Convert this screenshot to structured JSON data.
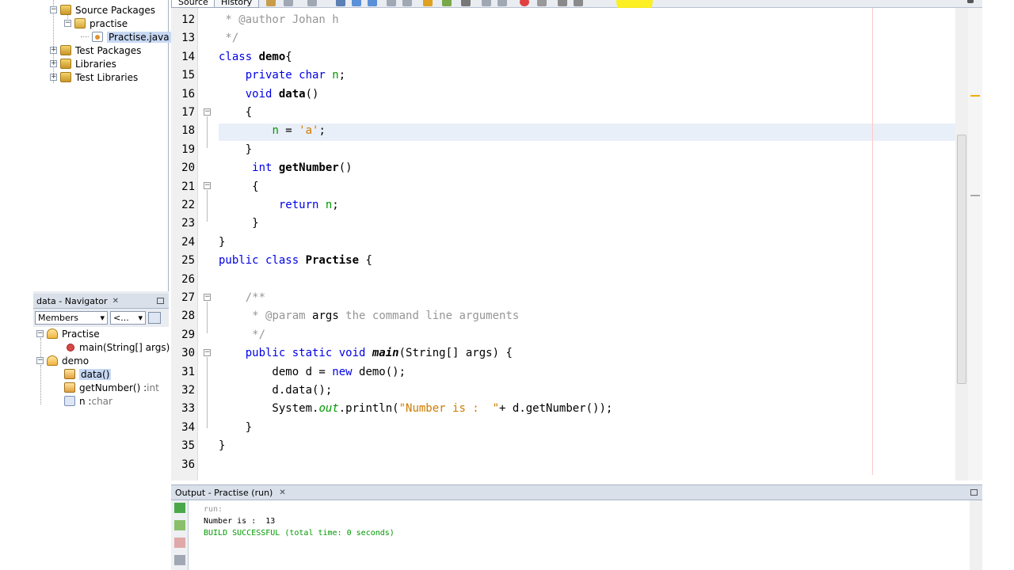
{
  "projects": {
    "items": [
      {
        "label": "Source Packages"
      },
      {
        "label": "practise"
      },
      {
        "label": "Practise.java"
      },
      {
        "label": "Test Packages"
      },
      {
        "label": "Libraries"
      },
      {
        "label": "Test Libraries"
      }
    ]
  },
  "navigator": {
    "title": "data - Navigator",
    "filter": "Members",
    "filter2": "<...",
    "items": [
      {
        "label": "Practise"
      },
      {
        "label": "main(String[] args)"
      },
      {
        "label": "demo"
      },
      {
        "label": "data()"
      },
      {
        "label": "getNumber() : ",
        "type": "int"
      },
      {
        "label": "n : ",
        "type": "char"
      }
    ]
  },
  "editor": {
    "tabs": {
      "source": "Source",
      "history": "History"
    },
    "lines": [
      {
        "n": "12",
        "tokens": [
          {
            "t": " * @author Johan h",
            "c": "cm"
          }
        ]
      },
      {
        "n": "13",
        "tokens": [
          {
            "t": " */",
            "c": "cm"
          }
        ]
      },
      {
        "n": "14",
        "tokens": [
          {
            "t": "class ",
            "c": "kw"
          },
          {
            "t": "demo",
            "c": "bold"
          },
          {
            "t": "{",
            "c": ""
          }
        ]
      },
      {
        "n": "15",
        "tokens": [
          {
            "t": "    private char ",
            "c": "kw"
          },
          {
            "t": "n",
            "c": "fld"
          },
          {
            "t": ";",
            "c": ""
          }
        ]
      },
      {
        "n": "16",
        "tokens": [
          {
            "t": "    void ",
            "c": "kw"
          },
          {
            "t": "data",
            "c": "bold"
          },
          {
            "t": "()",
            "c": ""
          }
        ]
      },
      {
        "n": "17",
        "tokens": [
          {
            "t": "    {",
            "c": ""
          }
        ]
      },
      {
        "n": "18",
        "tokens": [
          {
            "t": "        ",
            "c": ""
          },
          {
            "t": "n",
            "c": "fld"
          },
          {
            "t": " = ",
            "c": ""
          },
          {
            "t": "'a'",
            "c": "str"
          },
          {
            "t": ";",
            "c": ""
          }
        ]
      },
      {
        "n": "19",
        "tokens": [
          {
            "t": "    }",
            "c": ""
          }
        ]
      },
      {
        "n": "20",
        "tokens": [
          {
            "t": "     int ",
            "c": "kw"
          },
          {
            "t": "getNumber",
            "c": "bold"
          },
          {
            "t": "()",
            "c": ""
          }
        ]
      },
      {
        "n": "21",
        "tokens": [
          {
            "t": "     {",
            "c": ""
          }
        ]
      },
      {
        "n": "22",
        "tokens": [
          {
            "t": "         return ",
            "c": "kw"
          },
          {
            "t": "n",
            "c": "fld"
          },
          {
            "t": ";",
            "c": ""
          }
        ]
      },
      {
        "n": "23",
        "tokens": [
          {
            "t": "     }",
            "c": ""
          }
        ]
      },
      {
        "n": "24",
        "tokens": [
          {
            "t": "}",
            "c": ""
          }
        ]
      },
      {
        "n": "25",
        "tokens": [
          {
            "t": "public class ",
            "c": "kw"
          },
          {
            "t": "Practise",
            "c": "bold"
          },
          {
            "t": " {",
            "c": ""
          }
        ]
      },
      {
        "n": "26",
        "tokens": []
      },
      {
        "n": "27",
        "tokens": [
          {
            "t": "    /**",
            "c": "cm"
          }
        ]
      },
      {
        "n": "28",
        "tokens": [
          {
            "t": "     * ",
            "c": "cm"
          },
          {
            "t": "@param ",
            "c": "cm"
          },
          {
            "t": "args",
            "c": ""
          },
          {
            "t": " the command line arguments",
            "c": "cm"
          }
        ]
      },
      {
        "n": "29",
        "tokens": [
          {
            "t": "     */",
            "c": "cm"
          }
        ]
      },
      {
        "n": "30",
        "tokens": [
          {
            "t": "    public static void ",
            "c": "kw"
          },
          {
            "t": "main",
            "c": "bold it"
          },
          {
            "t": "(String[] args) {",
            "c": ""
          }
        ]
      },
      {
        "n": "31",
        "tokens": [
          {
            "t": "        demo d = ",
            "c": ""
          },
          {
            "t": "new ",
            "c": "kw"
          },
          {
            "t": "demo();",
            "c": ""
          }
        ]
      },
      {
        "n": "32",
        "tokens": [
          {
            "t": "        d.data();",
            "c": ""
          }
        ]
      },
      {
        "n": "33",
        "tokens": [
          {
            "t": "        System.",
            "c": ""
          },
          {
            "t": "out",
            "c": "fld it"
          },
          {
            "t": ".println(",
            "c": ""
          },
          {
            "t": "\"Number is :  \"",
            "c": "str"
          },
          {
            "t": "+ d.getNumber());",
            "c": ""
          }
        ]
      },
      {
        "n": "34",
        "tokens": [
          {
            "t": "    }",
            "c": ""
          }
        ]
      },
      {
        "n": "35",
        "tokens": [
          {
            "t": "}",
            "c": ""
          }
        ]
      },
      {
        "n": "36",
        "tokens": []
      }
    ]
  },
  "output": {
    "title": "Output - Practise (run)",
    "lines": [
      {
        "text": "run:",
        "color": "#999999"
      },
      {
        "text": "Number is :  13",
        "color": "#000000"
      },
      {
        "text": "BUILD SUCCESSFUL (total time: 0 seconds)",
        "color": "#009900"
      }
    ]
  },
  "colors": {
    "keyword": "#0000e6",
    "comment": "#969696",
    "string": "#ce7b00",
    "field": "#009900"
  }
}
